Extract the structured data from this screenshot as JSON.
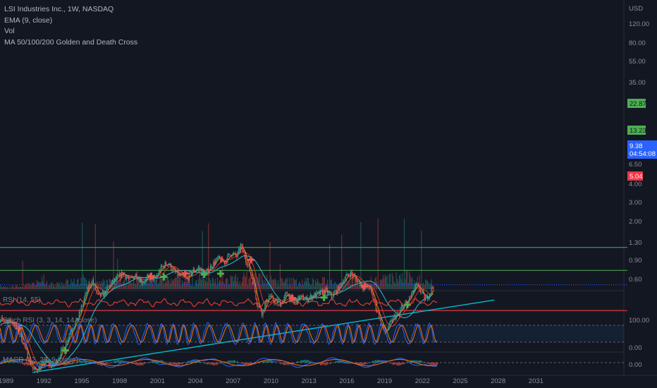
{
  "legend": {
    "title": "LSI Industries Inc., 1W, NASDAQ",
    "ema": "EMA (9, close)",
    "vol": "Vol",
    "ma_cross": "MA 50/100/200 Golden and Death Cross"
  },
  "panes": {
    "rsi_label": "RSI (14, 55)",
    "stoch_label": "Stoch RSI (3, 3, 14, 14, close)",
    "macd_label": "MACD (12, 26, 9, close)"
  },
  "badges": {
    "r1": "22.87",
    "r2": "13.23",
    "price": "9.38",
    "countdown": "04:54:08",
    "s1": "5.04"
  },
  "colors": {
    "background": "#131722",
    "up": "#26a69a",
    "down": "#ef5350",
    "ema": "#ff9800",
    "ma_teal": "#26c6da",
    "ma_red": "#e53935",
    "resistance": "#4caf50",
    "support": "#f23645",
    "trendline": "#00bcd4",
    "price_badge": "#2962ff"
  },
  "chart_data": {
    "type": "candlestick",
    "x_axis": {
      "label": "",
      "ticks": [
        "1989",
        "1992",
        "1995",
        "1998",
        "2001",
        "2004",
        "2007",
        "2010",
        "2013",
        "2016",
        "2019",
        "2022",
        "2025",
        "2028",
        "2031"
      ]
    },
    "y_axis": {
      "unit": "USD",
      "scale": "log",
      "ticks": [
        "120.00",
        "80.00",
        "55.00",
        "35.00",
        "6.50",
        "4.00",
        "3.00",
        "2.00",
        "1.30",
        "0.90",
        "0.60",
        "0.00"
      ]
    },
    "price_series": [
      [
        1988.2,
        3.4
      ],
      [
        1988.7,
        4.1
      ],
      [
        1989.3,
        3.9
      ],
      [
        1989.8,
        3.5
      ],
      [
        1990.3,
        2.5
      ],
      [
        1990.8,
        1.6
      ],
      [
        1991.2,
        1.2
      ],
      [
        1991.7,
        1.3
      ],
      [
        1992.2,
        1.5
      ],
      [
        1992.7,
        1.3
      ],
      [
        1993.2,
        1.7
      ],
      [
        1993.7,
        2.3
      ],
      [
        1994.2,
        3.3
      ],
      [
        1994.7,
        4.2
      ],
      [
        1995.0,
        5.6
      ],
      [
        1995.4,
        8.0
      ],
      [
        1995.8,
        10.5
      ],
      [
        1996.3,
        7.0
      ],
      [
        1996.8,
        7.6
      ],
      [
        1997.3,
        9.5
      ],
      [
        1997.8,
        11.0
      ],
      [
        1998.3,
        12.5
      ],
      [
        1998.8,
        10.5
      ],
      [
        1999.3,
        12.0
      ],
      [
        1999.8,
        10.0
      ],
      [
        2000.3,
        11.2
      ],
      [
        2000.8,
        10.8
      ],
      [
        2001.3,
        14.0
      ],
      [
        2001.8,
        16.0
      ],
      [
        2002.3,
        13.0
      ],
      [
        2002.8,
        11.5
      ],
      [
        2003.3,
        10.5
      ],
      [
        2003.8,
        13.0
      ],
      [
        2004.3,
        14.0
      ],
      [
        2004.8,
        12.0
      ],
      [
        2005.3,
        15.0
      ],
      [
        2005.8,
        17.5
      ],
      [
        2006.3,
        16.0
      ],
      [
        2006.8,
        20.0
      ],
      [
        2007.3,
        18.5
      ],
      [
        2007.6,
        24.0
      ],
      [
        2008.1,
        16.0
      ],
      [
        2008.6,
        10.0
      ],
      [
        2008.9,
        6.0
      ],
      [
        2009.3,
        4.8
      ],
      [
        2009.8,
        7.2
      ],
      [
        2010.3,
        6.3
      ],
      [
        2010.8,
        6.0
      ],
      [
        2011.3,
        7.8
      ],
      [
        2011.8,
        6.0
      ],
      [
        2012.3,
        7.0
      ],
      [
        2012.8,
        6.6
      ],
      [
        2013.3,
        7.2
      ],
      [
        2013.8,
        7.6
      ],
      [
        2014.3,
        8.2
      ],
      [
        2014.8,
        7.0
      ],
      [
        2015.3,
        8.5
      ],
      [
        2015.8,
        10.8
      ],
      [
        2016.3,
        12.5
      ],
      [
        2016.8,
        10.5
      ],
      [
        2017.3,
        9.0
      ],
      [
        2017.8,
        9.0
      ],
      [
        2018.2,
        6.0
      ],
      [
        2018.6,
        4.3
      ],
      [
        2019.0,
        2.9
      ],
      [
        2019.4,
        3.6
      ],
      [
        2019.8,
        4.4
      ],
      [
        2020.1,
        4.5
      ],
      [
        2020.4,
        5.6
      ],
      [
        2020.8,
        6.2
      ],
      [
        2021.2,
        7.6
      ],
      [
        2021.5,
        9.2
      ],
      [
        2021.9,
        8.0
      ],
      [
        2022.2,
        6.5
      ],
      [
        2022.6,
        7.8
      ],
      [
        2022.9,
        9.38
      ]
    ],
    "volume_series": [
      [
        1988.5,
        1
      ],
      [
        1989.5,
        1
      ],
      [
        1990.5,
        1.5
      ],
      [
        1991.5,
        2
      ],
      [
        1992.5,
        2
      ],
      [
        1993.5,
        2.5
      ],
      [
        1994.5,
        3
      ],
      [
        1995.5,
        4
      ],
      [
        1996.5,
        3
      ],
      [
        1997.5,
        3
      ],
      [
        1998.5,
        3.5
      ],
      [
        1999.5,
        3
      ],
      [
        2000.5,
        3
      ],
      [
        2001.5,
        3.5
      ],
      [
        2002.5,
        3
      ],
      [
        2003.5,
        3
      ],
      [
        2004.5,
        3.5
      ],
      [
        2005.5,
        3
      ],
      [
        2006.5,
        3.5
      ],
      [
        2007.5,
        4
      ],
      [
        2008.5,
        5
      ],
      [
        2009.5,
        4
      ],
      [
        2010.5,
        3
      ],
      [
        2011.5,
        3
      ],
      [
        2012.5,
        3
      ],
      [
        2013.5,
        3
      ],
      [
        2014.5,
        3
      ],
      [
        2015.5,
        3
      ],
      [
        2016.5,
        4
      ],
      [
        2017.5,
        3
      ],
      [
        2018.5,
        4
      ],
      [
        2019.5,
        4
      ],
      [
        2020.5,
        5
      ],
      [
        2021.5,
        4
      ],
      [
        2022.5,
        3
      ]
    ],
    "levels": [
      {
        "price": 22.87,
        "type": "resistance"
      },
      {
        "price": 13.23,
        "type": "resistance"
      },
      {
        "price": 9.38,
        "type": "last"
      },
      {
        "price": 5.04,
        "type": "support"
      }
    ],
    "trendline": {
      "from": [
        1991.1,
        1.15
      ],
      "to": [
        2027.7,
        6.5
      ]
    },
    "cross_markers": [
      {
        "x": 1988.3,
        "y": 3.2,
        "kind": "golden"
      },
      {
        "x": 1990.0,
        "y": 3.3,
        "kind": "death"
      },
      {
        "x": 1993.7,
        "y": 1.95,
        "kind": "golden"
      },
      {
        "x": 2000.5,
        "y": 11.5,
        "kind": "death"
      },
      {
        "x": 2001.5,
        "y": 11.3,
        "kind": "golden"
      },
      {
        "x": 2003.2,
        "y": 12.3,
        "kind": "death"
      },
      {
        "x": 2004.7,
        "y": 12.0,
        "kind": "golden"
      },
      {
        "x": 2006.0,
        "y": 12.2,
        "kind": "golden"
      },
      {
        "x": 2008.4,
        "y": 17.0,
        "kind": "death"
      },
      {
        "x": 2011.7,
        "y": 6.8,
        "kind": "death"
      },
      {
        "x": 2014.2,
        "y": 6.9,
        "kind": "golden"
      },
      {
        "x": 2017.4,
        "y": 9.0,
        "kind": "death"
      },
      {
        "x": 2020.8,
        "y": 5.8,
        "kind": "golden"
      }
    ],
    "stoch_levels": [
      80,
      20
    ]
  }
}
